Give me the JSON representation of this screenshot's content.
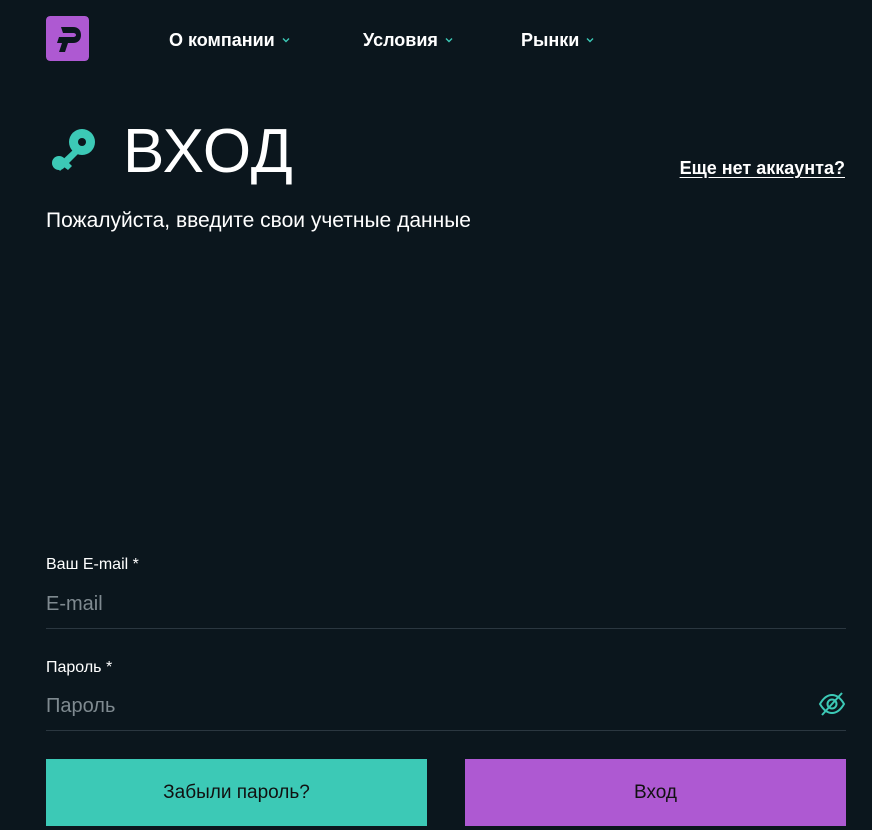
{
  "header": {
    "logo_alt": "logo",
    "nav": [
      {
        "label": "О компании"
      },
      {
        "label": "Условия"
      },
      {
        "label": "Рынки"
      }
    ]
  },
  "auth": {
    "title": "ВХОД",
    "register_link": "Еще нет аккаунта?",
    "subtitle": "Пожалуйста, введите свои учетные данные"
  },
  "form": {
    "email_label": "Ваш E-mail *",
    "email_placeholder": "E-mail",
    "email_value": "",
    "password_label": "Пароль *",
    "password_placeholder": "Пароль",
    "password_value": ""
  },
  "buttons": {
    "forgot_label": "Забыли пароль?",
    "login_label": "Вход"
  },
  "colors": {
    "background": "#0b161d",
    "accent_teal": "#3cc9b6",
    "accent_purple": "#ae59d2"
  },
  "icons": {
    "logo": "brand-logo-icon",
    "key": "key-icon",
    "chevron": "chevron-down-icon",
    "eye": "eye-off-icon"
  }
}
